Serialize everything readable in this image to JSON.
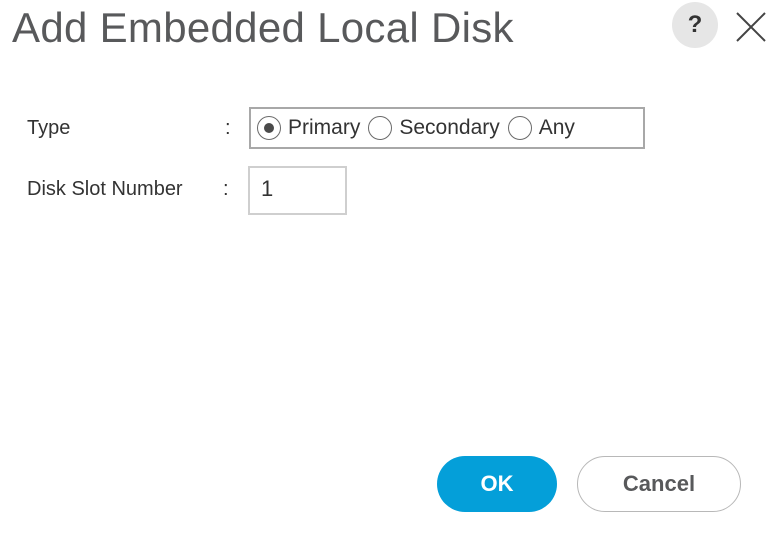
{
  "dialog": {
    "title": "Add Embedded Local Disk",
    "help_label": "?",
    "close_icon": "close-x-icon"
  },
  "form": {
    "type": {
      "label": "Type",
      "colon": ":",
      "options": [
        {
          "label": "Primary",
          "selected": true
        },
        {
          "label": "Secondary",
          "selected": false
        },
        {
          "label": "Any",
          "selected": false
        }
      ]
    },
    "disk_slot": {
      "label": "Disk Slot Number",
      "colon": ":",
      "value": "1"
    }
  },
  "buttons": {
    "ok_label": "OK",
    "cancel_label": "Cancel"
  },
  "colors": {
    "primary": "#049fd9",
    "title": "#58595b"
  }
}
